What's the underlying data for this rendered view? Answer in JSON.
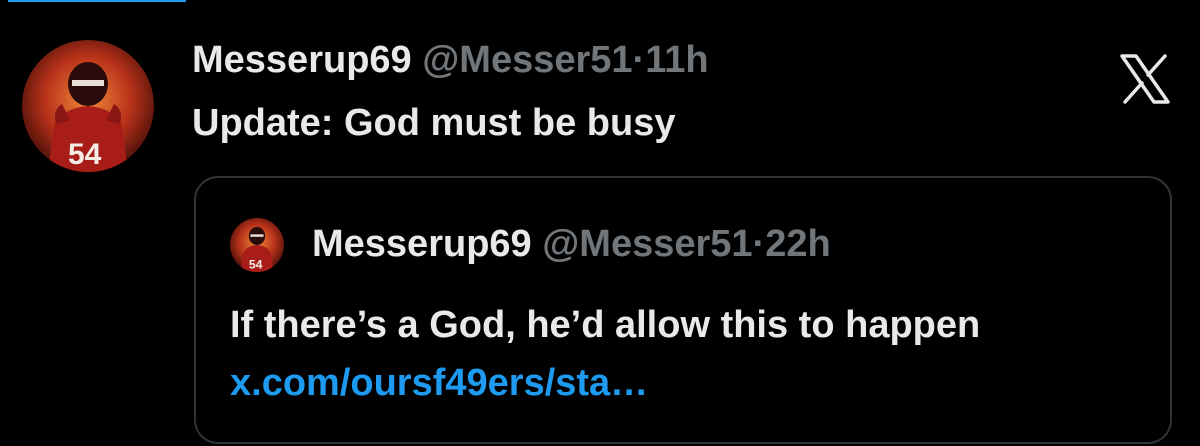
{
  "tweet": {
    "author_name": "Messerup69",
    "handle": "@Messer51",
    "separator": "·",
    "time": "11h",
    "text": "Update: God must be busy",
    "avatar_icon": "football-player-avatar"
  },
  "quoted": {
    "author_name": "Messerup69",
    "handle": "@Messer51",
    "separator": "·",
    "time": "22h",
    "text": "If there’s a God, he’d allow this to happen",
    "link": "x.com/oursf49ers/sta…",
    "avatar_icon": "football-player-avatar"
  },
  "toolbar": {
    "close_icon": "x-logo-icon"
  },
  "colors": {
    "background": "#000000",
    "text": "#e7e9ea",
    "muted": "#71767b",
    "link": "#1d9bf0",
    "border": "#2f3336",
    "avatar_red": "#c0271e"
  }
}
